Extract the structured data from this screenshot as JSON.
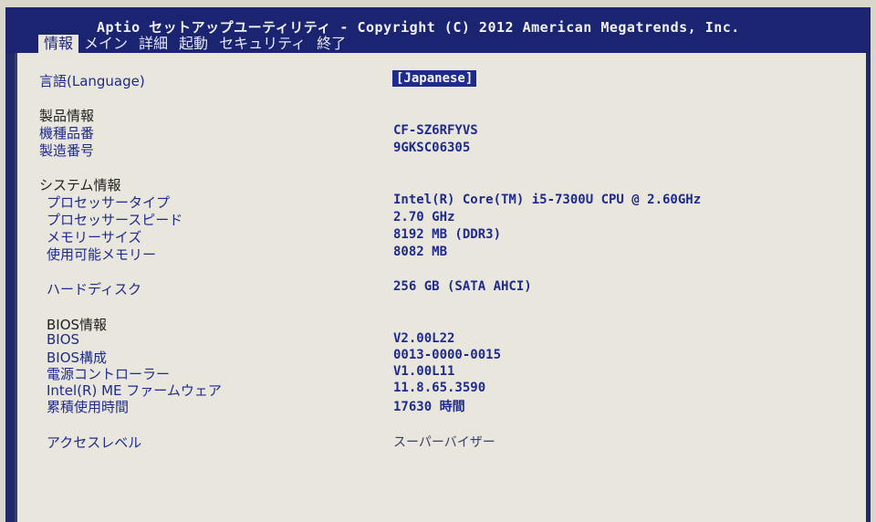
{
  "header": {
    "title": "Aptio セットアップユーティリティ - Copyright (C) 2012 American Megatrends, Inc."
  },
  "tabs": [
    {
      "label": "情報",
      "active": true
    },
    {
      "label": "メイン"
    },
    {
      "label": "詳細"
    },
    {
      "label": "起動"
    },
    {
      "label": "セキュリティ"
    },
    {
      "label": "終了"
    }
  ],
  "language": {
    "label": "言語(Language)",
    "value": "[Japanese]"
  },
  "product": {
    "heading": "製品情報",
    "model_label": "機種品番",
    "model_value": "CF-SZ6RFYVS",
    "serial_label": "製造番号",
    "serial_value": "9GKSC06305"
  },
  "system": {
    "heading": "システム情報",
    "cpu_type_label": "プロセッサータイプ",
    "cpu_type_value": "Intel(R) Core(TM) i5-7300U CPU @ 2.60GHz",
    "cpu_speed_label": "プロセッサースピード",
    "cpu_speed_value": "2.70 GHz",
    "mem_size_label": "メモリーサイズ",
    "mem_size_value": "8192 MB (DDR3)",
    "mem_avail_label": "使用可能メモリー",
    "mem_avail_value": "8082 MB"
  },
  "disk": {
    "label": "ハードディスク",
    "value": "256 GB (SATA AHCI)"
  },
  "bios": {
    "heading": "BIOS情報",
    "bios_label": "BIOS",
    "bios_value": "V2.00L22",
    "config_label": "BIOS構成",
    "config_value": "0013-0000-0015",
    "power_label": "電源コントローラー",
    "power_value": "V1.00L11",
    "me_label": "Intel(R) ME ファームウェア",
    "me_value": "11.8.65.3590",
    "hours_label": "累積使用時間",
    "hours_value": "17630 時間"
  },
  "access": {
    "label": "アクセスレベル",
    "value": "スーパーバイザー"
  }
}
